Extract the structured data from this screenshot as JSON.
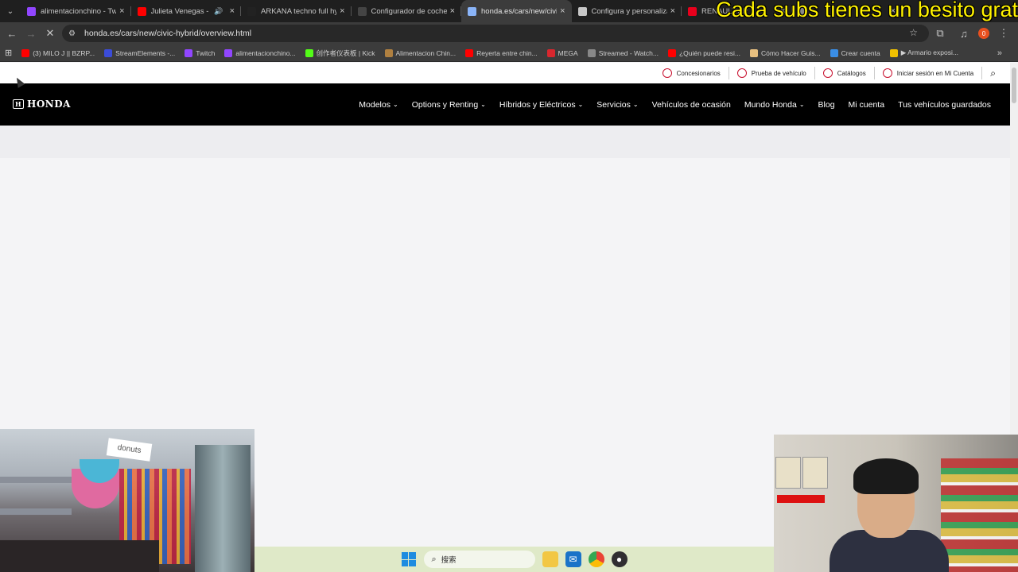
{
  "browser": {
    "tabs": [
      {
        "title": "alimentacionchino - Tw",
        "favicon": "twitch-icon",
        "color": "#9146ff"
      },
      {
        "title": "Julieta Venegas - Le",
        "favicon": "youtube-icon",
        "color": "#ff0000",
        "audio": true
      },
      {
        "title": "ARKANA techno full hy",
        "favicon": "circle-icon",
        "color": "#222222"
      },
      {
        "title": "Configurador de coche",
        "favicon": "car-icon",
        "color": "#444444"
      },
      {
        "title": "honda.es/cars/new/civi",
        "favicon": "loading-icon",
        "color": "#8ab4f8",
        "active": true
      },
      {
        "title": "Configura y personaliza",
        "favicon": "globe-icon",
        "color": "#c7c7c7"
      },
      {
        "title": "RENAULT AR",
        "favicon": "renault-icon",
        "color": "#e8001c"
      },
      {
        "title": "",
        "favicon": "globe-icon",
        "color": "#888888"
      }
    ],
    "overlay_text": "Cada subs tienes un besito grat",
    "url": "honda.es/cars/new/civic-hybrid/overview.html",
    "profile_badge": "0",
    "bookmarks": [
      {
        "label": "(3) MILO J || BZRP...",
        "favicon": "youtube-icon",
        "color": "#ff0000"
      },
      {
        "label": "StreamElements -...",
        "favicon": "streamelements-icon",
        "color": "#3b4cd8"
      },
      {
        "label": "Twitch",
        "favicon": "twitch-icon",
        "color": "#9146ff"
      },
      {
        "label": "alimentacionchino...",
        "favicon": "twitch-icon",
        "color": "#9146ff"
      },
      {
        "label": "创作者仪表板 | Kick",
        "favicon": "kick-icon",
        "color": "#53fc18"
      },
      {
        "label": "Alimentacion Chin...",
        "favicon": "bag-icon",
        "color": "#b08040"
      },
      {
        "label": "Reyerta entre chin...",
        "favicon": "youtube-icon",
        "color": "#ff0000"
      },
      {
        "label": "MEGA",
        "favicon": "mega-icon",
        "color": "#d9272e"
      },
      {
        "label": "Streamed - Watch...",
        "favicon": "shield-icon",
        "color": "#888888"
      },
      {
        "label": "¿Quién puede resi...",
        "favicon": "youtube-icon",
        "color": "#ff0000"
      },
      {
        "label": "Cómo Hacer Guis...",
        "favicon": "circle-icon",
        "color": "#e8c080"
      },
      {
        "label": "Crear cuenta",
        "favicon": "pen-icon",
        "color": "#3a8ee6"
      },
      {
        "label": "▶ Armario exposi...",
        "favicon": "ring-icon",
        "color": "#f0c000"
      }
    ]
  },
  "site": {
    "utility": [
      {
        "label": "Concesionarios",
        "icon": "location-icon"
      },
      {
        "label": "Prueba de vehículo",
        "icon": "steering-wheel-icon"
      },
      {
        "label": "Catálogos",
        "icon": "catalog-icon"
      },
      {
        "label": "Iniciar sesión en Mi Cuenta",
        "icon": "user-icon"
      }
    ],
    "logo_text": "HONDA",
    "nav": [
      {
        "label": "Modelos",
        "dropdown": true
      },
      {
        "label": "Options y Renting",
        "dropdown": true
      },
      {
        "label": "Híbridos y Eléctricos",
        "dropdown": true
      },
      {
        "label": "Servicios",
        "dropdown": true
      },
      {
        "label": "Vehículos de ocasión",
        "dropdown": false
      },
      {
        "label": "Mundo Honda",
        "dropdown": true
      },
      {
        "label": "Blog",
        "dropdown": false
      },
      {
        "label": "Mi cuenta",
        "dropdown": false
      },
      {
        "label": "Tus vehículos guardados",
        "dropdown": false
      }
    ]
  },
  "webcam_left": {
    "sign_text": "donuts"
  },
  "taskbar": {
    "search_placeholder": "搜索",
    "apps": [
      "file-explorer-icon",
      "outlook-icon",
      "chrome-icon",
      "obs-icon"
    ]
  }
}
